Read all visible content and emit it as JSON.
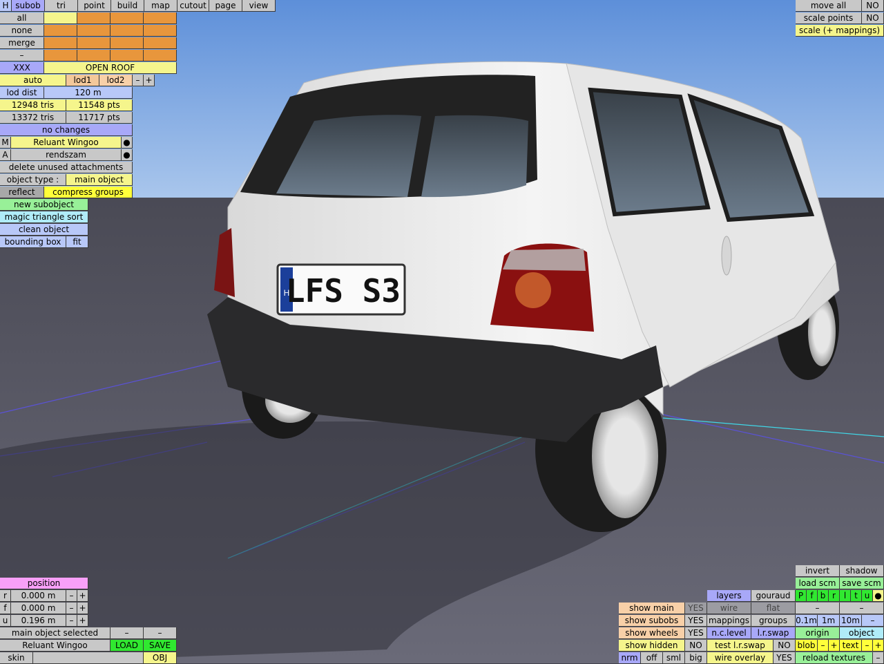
{
  "tabs": {
    "h": "H",
    "subob": "subob",
    "tri": "tri",
    "point": "point",
    "build": "build",
    "map": "map",
    "cutout": "cutout",
    "page": "page",
    "view": "view"
  },
  "select": {
    "all": "all",
    "none": "none",
    "merge": "merge",
    "dash": "–"
  },
  "subobject": {
    "xxx": "XXX",
    "name": "OPEN ROOF"
  },
  "lod": {
    "auto": "auto",
    "lod1": "lod1",
    "lod2": "lod2",
    "minus": "–",
    "plus": "+",
    "dist_label": "lod dist",
    "dist_value": "120 m"
  },
  "stats": {
    "tris1": "12948 tris",
    "pts1": "11548 pts",
    "tris2": "13372 tris",
    "pts2": "11717 pts"
  },
  "status": "no changes",
  "object": {
    "m": "M",
    "model": "Reluant Wingoo",
    "a": "A",
    "author": "rendszam",
    "dot": "●",
    "delete": "delete unused attachments",
    "type_label": "object type :",
    "type_value": "main object",
    "reflect": "reflect",
    "compress": "compress groups",
    "new_sub": "new subobject",
    "magic": "magic triangle sort",
    "clean": "clean object",
    "bbox": "bounding box",
    "fit": "fit"
  },
  "topright": {
    "move_all": "move all",
    "move_val": "NO",
    "scale_points": "scale points",
    "scale_val": "NO",
    "scale_map": "scale (+ mappings)"
  },
  "position": {
    "title": "position",
    "r": "r",
    "r_val": "0.000 m",
    "f": "f",
    "f_val": "0.000 m",
    "u": "u",
    "u_val": "0.196 m",
    "minus": "–",
    "plus": "+"
  },
  "bottomleft": {
    "selected": "main object selected",
    "minus": "–",
    "model": "Reluant Wingoo",
    "load": "LOAD",
    "save": "SAVE",
    "skin": "skin",
    "obj": "OBJ"
  },
  "show": {
    "main": "show main",
    "main_v": "YES",
    "subobs": "show subobs",
    "subobs_v": "YES",
    "wheels": "show wheels",
    "wheels_v": "YES",
    "hidden": "show hidden",
    "hidden_v": "NO",
    "nrm": "nrm",
    "off": "off",
    "sml": "sml",
    "big": "big"
  },
  "view": {
    "layers": "layers",
    "gouraud": "gouraud",
    "wire": "wire",
    "flat": "flat",
    "mappings": "mappings",
    "groups": "groups",
    "nclevel": "n.c.level",
    "lrswap": "l.r.swap",
    "test": "test l.r.swap",
    "test_v": "NO",
    "overlay": "wire overlay",
    "overlay_v": "YES"
  },
  "env": {
    "invert": "invert",
    "shadow": "shadow",
    "load_scm": "load scm",
    "save_scm": "save scm",
    "letters": [
      "P",
      "f",
      "b",
      "r",
      "l",
      "t",
      "u"
    ],
    "dot": "●",
    "minus": "–",
    "g1": "0.1m",
    "g2": "1m",
    "g3": "10m",
    "origin": "origin",
    "objectb": "object",
    "blob": "blob",
    "text": "text",
    "plus": "+",
    "reload": "reload textures"
  },
  "scene": {
    "plate": "LFS S3",
    "plate_region": "H"
  }
}
